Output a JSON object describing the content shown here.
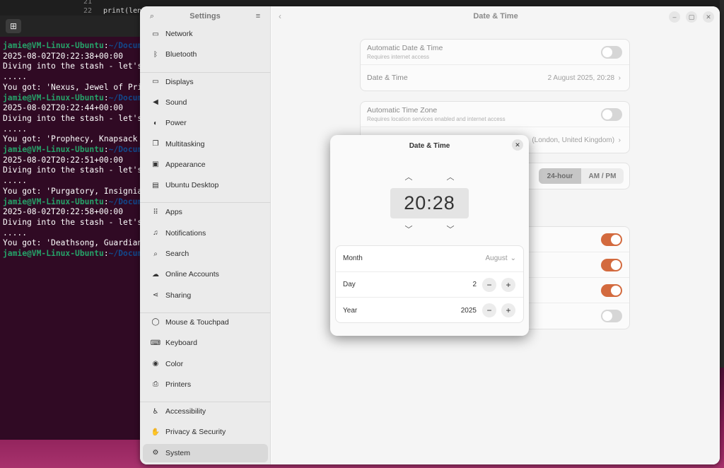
{
  "editor": {
    "line_numbers": [
      "21",
      "22"
    ],
    "code_line": "print(len"
  },
  "terminal": {
    "new_tab_icon": "new-tab-icon",
    "lines": [
      {
        "type": "prompt",
        "user": "jamie@VM-Linux-Ubuntu",
        "sep": ":",
        "path": "~/Docum"
      },
      {
        "type": "text",
        "text": "2025-08-02T20:22:38+00:00"
      },
      {
        "type": "text",
        "text": "Diving into the stash - let's"
      },
      {
        "type": "text",
        "text": "....."
      },
      {
        "type": "text",
        "text": "You got: 'Nexus, Jewel of Pri"
      },
      {
        "type": "prompt",
        "user": "jamie@VM-Linux-Ubuntu",
        "sep": ":",
        "path": "~/Docum"
      },
      {
        "type": "text",
        "text": "2025-08-02T20:22:44+00:00"
      },
      {
        "type": "text",
        "text": "Diving into the stash - let's"
      },
      {
        "type": "text",
        "text": "....."
      },
      {
        "type": "text",
        "text": "You got: 'Prophecy, Knapsack"
      },
      {
        "type": "prompt",
        "user": "jamie@VM-Linux-Ubuntu",
        "sep": ":",
        "path": "~/Docum"
      },
      {
        "type": "text",
        "text": "2025-08-02T20:22:51+00:00"
      },
      {
        "type": "text",
        "text": "Diving into the stash - let's"
      },
      {
        "type": "text",
        "text": "....."
      },
      {
        "type": "text",
        "text": "You got: 'Purgatory, Insignia"
      },
      {
        "type": "prompt",
        "user": "jamie@VM-Linux-Ubuntu",
        "sep": ":",
        "path": "~/Docum"
      },
      {
        "type": "text",
        "text": "2025-08-02T20:22:58+00:00"
      },
      {
        "type": "text",
        "text": "Diving into the stash - let's"
      },
      {
        "type": "text",
        "text": "....."
      },
      {
        "type": "text",
        "text": "You got: 'Deathsong, Guardian"
      },
      {
        "type": "prompt",
        "user": "jamie@VM-Linux-Ubuntu",
        "sep": ":",
        "path": "~/Docum"
      }
    ]
  },
  "settings": {
    "sidebar_title": "Settings",
    "sidebar_items": [
      {
        "label": "Network",
        "icon": "network-icon",
        "glyph": "▭"
      },
      {
        "label": "Bluetooth",
        "icon": "bluetooth-icon",
        "glyph": "ᛒ"
      },
      {
        "label": "Displays",
        "icon": "display-icon",
        "glyph": "▭"
      },
      {
        "label": "Sound",
        "icon": "speaker-icon",
        "glyph": "◀"
      },
      {
        "label": "Power",
        "icon": "power-icon",
        "glyph": "◐"
      },
      {
        "label": "Multitasking",
        "icon": "multitasking-icon",
        "glyph": "❐"
      },
      {
        "label": "Appearance",
        "icon": "appearance-icon",
        "glyph": "▣"
      },
      {
        "label": "Ubuntu Desktop",
        "icon": "ubuntu-desktop-icon",
        "glyph": "▤"
      },
      {
        "label": "Apps",
        "icon": "apps-grid-icon",
        "glyph": "⠿"
      },
      {
        "label": "Notifications",
        "icon": "bell-icon",
        "glyph": "♫"
      },
      {
        "label": "Search",
        "icon": "search-icon",
        "glyph": "⌕"
      },
      {
        "label": "Online Accounts",
        "icon": "cloud-icon",
        "glyph": "☁"
      },
      {
        "label": "Sharing",
        "icon": "share-icon",
        "glyph": "⋖"
      },
      {
        "label": "Mouse & Touchpad",
        "icon": "mouse-icon",
        "glyph": "◯"
      },
      {
        "label": "Keyboard",
        "icon": "keyboard-icon",
        "glyph": "⌨"
      },
      {
        "label": "Color",
        "icon": "color-icon",
        "glyph": "◉"
      },
      {
        "label": "Printers",
        "icon": "printer-icon",
        "glyph": "⎙"
      },
      {
        "label": "Accessibility",
        "icon": "accessibility-icon",
        "glyph": "♿"
      },
      {
        "label": "Privacy & Security",
        "icon": "hand-icon",
        "glyph": "✋"
      },
      {
        "label": "System",
        "icon": "gear-icon",
        "glyph": "⚙"
      }
    ],
    "active_item": "System",
    "page_title": "Date & Time",
    "auto_datetime": {
      "title": "Automatic Date & Time",
      "subtitle": "Requires internet access",
      "on": false
    },
    "datetime": {
      "title": "Date & Time",
      "value": "2 August 2025, 20:28"
    },
    "auto_timezone": {
      "title": "Automatic Time Zone",
      "subtitle": "Requires location services enabled and internet access",
      "on": false
    },
    "timezone": {
      "value": "(London, United Kingdom)"
    },
    "time_format": {
      "options": [
        "24-hour",
        "AM / PM"
      ],
      "selected": "24-hour"
    },
    "toggles_lower": [
      true,
      true,
      true,
      false
    ]
  },
  "dialog": {
    "title": "Date & Time",
    "time": "20:28",
    "month_label": "Month",
    "month_value": "August",
    "day_label": "Day",
    "day_value": "2",
    "year_label": "Year",
    "year_value": "2025"
  }
}
